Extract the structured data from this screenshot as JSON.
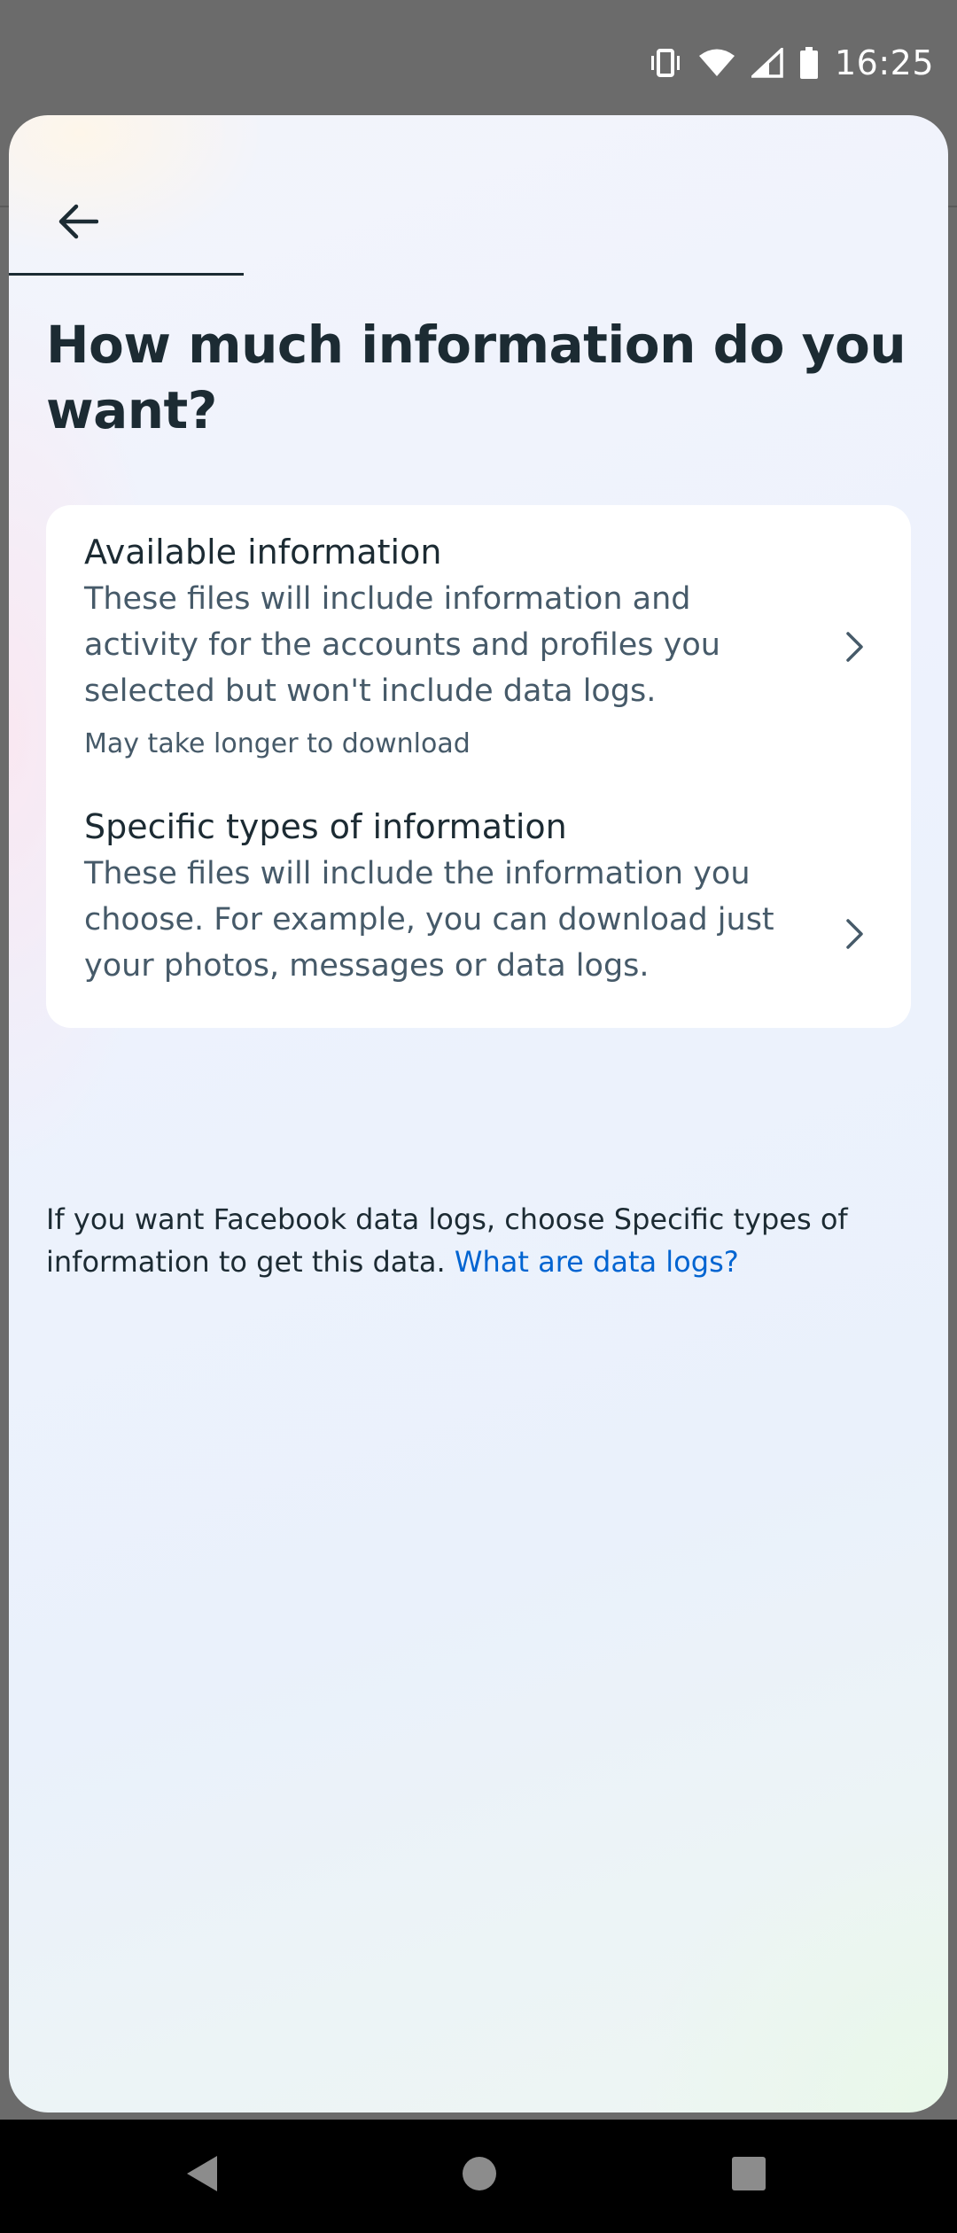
{
  "status_bar": {
    "time": "16:25",
    "icons": [
      "vibrate-icon",
      "wifi-icon",
      "cellular-signal-icon",
      "battery-icon"
    ]
  },
  "header": {
    "back_icon": "arrow-left-icon",
    "progress_fraction": 0.25
  },
  "page": {
    "title": "How much information do you want?"
  },
  "options": [
    {
      "title": "Available information",
      "description": "These files will include information and activity for the accounts and profiles you selected but won't include data logs.",
      "note": "May take longer to download",
      "icon": "chevron-right-icon"
    },
    {
      "title": "Specific types of information",
      "description": "These files will include the information you choose. For example, you can download just your photos, messages or data logs.",
      "icon": "chevron-right-icon"
    }
  ],
  "footer": {
    "text": "If you want Facebook data logs, choose Specific types of information to get this data. ",
    "link_label": "What are data logs?"
  },
  "colors": {
    "text_primary": "#1c2b33",
    "text_secondary": "#465a69",
    "link": "#0064d1",
    "card_bg": "#ffffff"
  }
}
